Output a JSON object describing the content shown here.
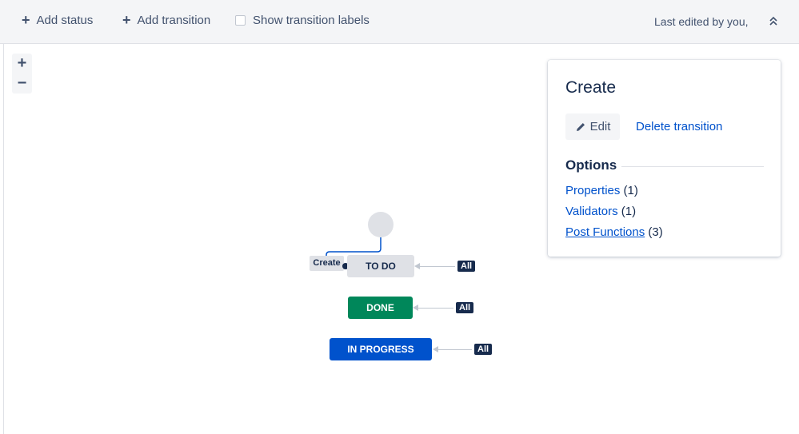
{
  "toolbar": {
    "add_status": "Add status",
    "add_transition": "Add transition",
    "show_transition_labels": "Show transition labels",
    "show_transition_labels_checked": false,
    "last_edited": "Last edited by you,"
  },
  "zoom": {
    "zoom_in": "+",
    "zoom_out": "−"
  },
  "workflow": {
    "transition_label": "Create",
    "statuses": [
      {
        "name": "TO DO",
        "color": "#dfe1e6"
      },
      {
        "name": "DONE",
        "color": "#00875a"
      },
      {
        "name": "IN PROGRESS",
        "color": "#0052cc"
      }
    ],
    "all_badge": "All"
  },
  "panel": {
    "title": "Create",
    "edit_label": "Edit",
    "delete_label": "Delete transition",
    "options_heading": "Options",
    "options": [
      {
        "label": "Properties",
        "count": "(1)"
      },
      {
        "label": "Validators",
        "count": "(1)"
      },
      {
        "label": "Post Functions",
        "count": "(3)"
      }
    ]
  },
  "colors": {
    "accent": "#0052cc",
    "done": "#00875a",
    "todo": "#dfe1e6",
    "text": "#172b4d"
  }
}
